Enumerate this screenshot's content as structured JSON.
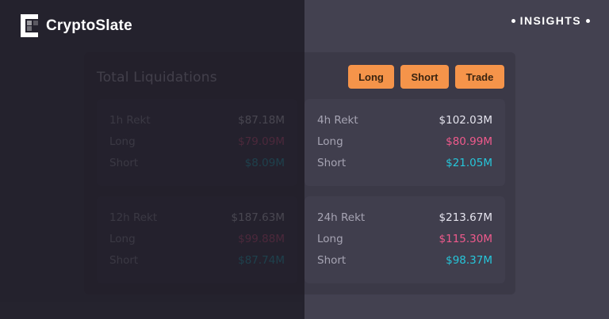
{
  "brand": {
    "name": "CryptoSlate"
  },
  "badge": {
    "label": "INSIGHTS"
  },
  "panel": {
    "title": "Total Liquidations",
    "buttons": [
      "Long",
      "Short",
      "Trade"
    ],
    "cards": [
      {
        "period": "1h Rekt",
        "total": "$87.18M",
        "long_label": "Long",
        "long": "$79.09M",
        "short_label": "Short",
        "short": "$8.09M"
      },
      {
        "period": "4h Rekt",
        "total": "$102.03M",
        "long_label": "Long",
        "long": "$80.99M",
        "short_label": "Short",
        "short": "$21.05M"
      },
      {
        "period": "12h Rekt",
        "total": "$187.63M",
        "long_label": "Long",
        "long": "$99.88M",
        "short_label": "Short",
        "short": "$87.74M"
      },
      {
        "period": "24h Rekt",
        "total": "$213.67M",
        "long_label": "Long",
        "long": "$115.30M",
        "short_label": "Short",
        "short": "$98.37M"
      }
    ]
  },
  "colors": {
    "accent": "#f5944a",
    "long": "#ef5a8c",
    "short": "#26c6da"
  }
}
